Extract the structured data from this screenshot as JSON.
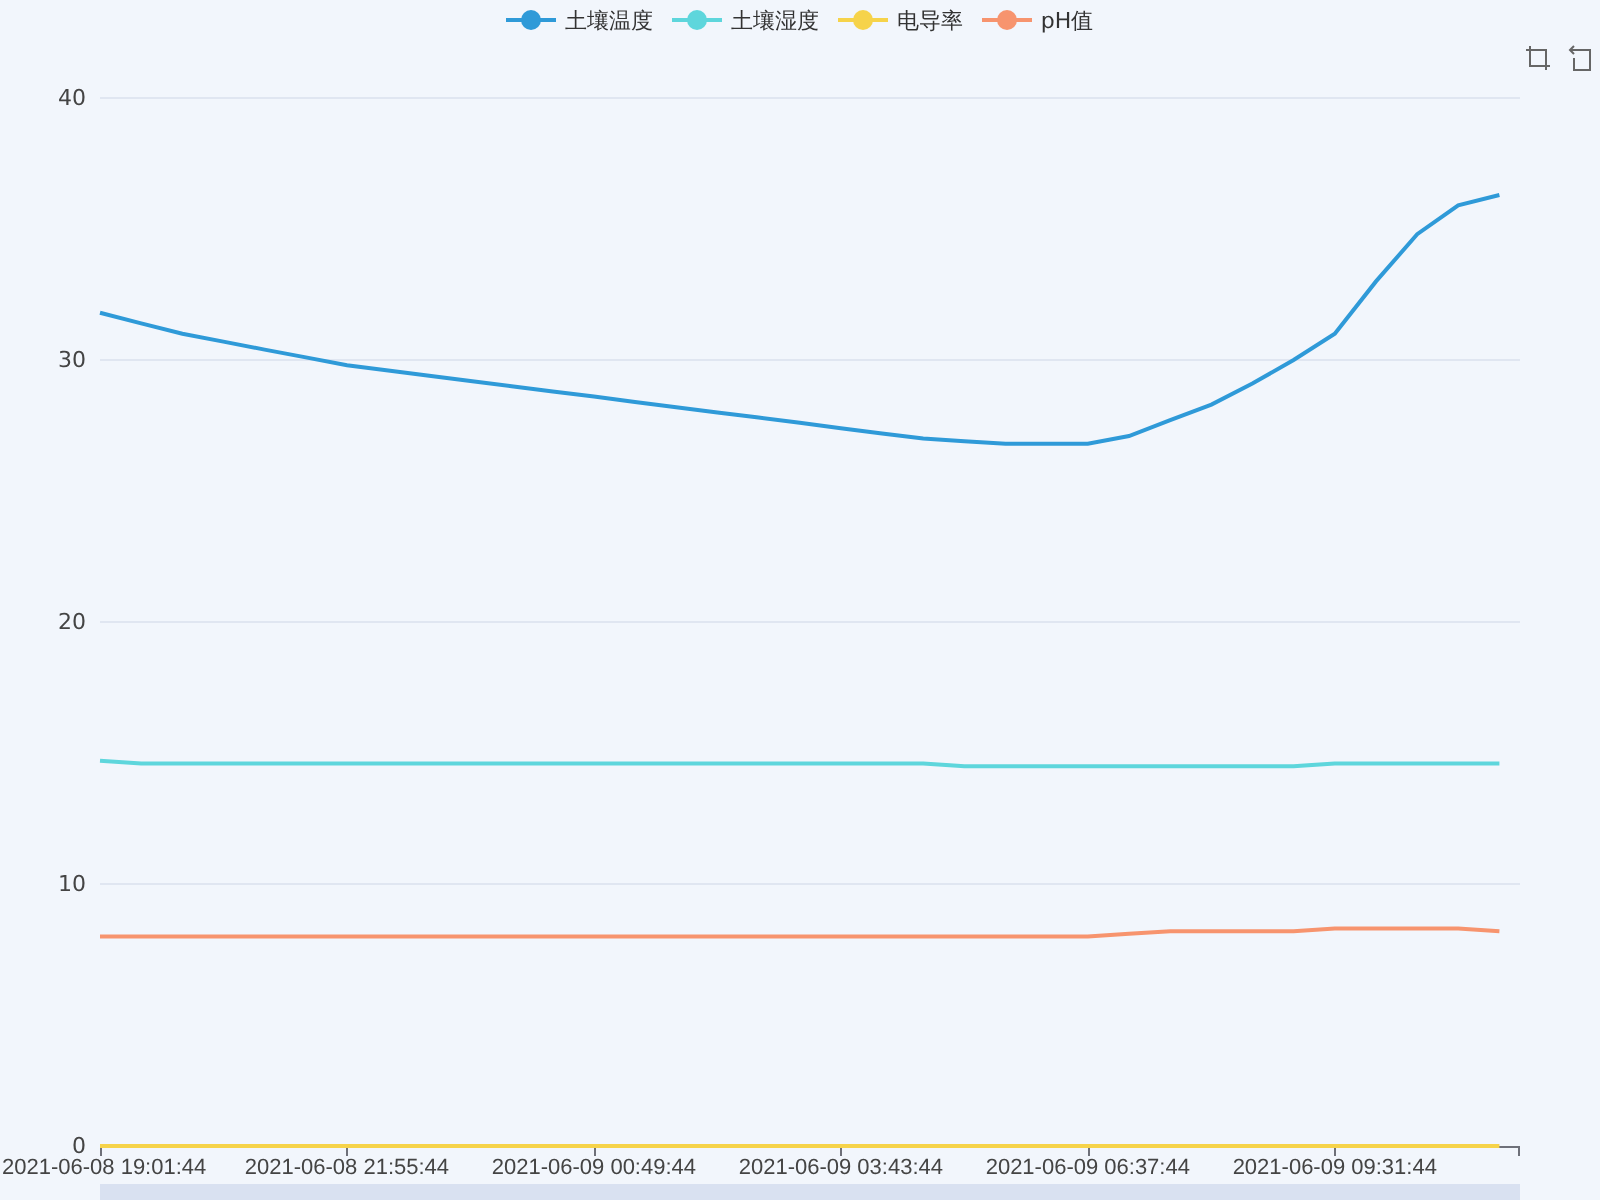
{
  "chart_data": {
    "type": "line",
    "categories": [
      "2021-06-08 19:01:44",
      null,
      null,
      null,
      null,
      null,
      "2021-06-08 21:55:44",
      null,
      null,
      null,
      null,
      null,
      "2021-06-09 00:49:44",
      null,
      null,
      null,
      null,
      null,
      "2021-06-09 03:43:44",
      null,
      null,
      null,
      null,
      null,
      "2021-06-09 06:37:44",
      null,
      null,
      null,
      null,
      null,
      "2021-06-09 09:31:44",
      null,
      null,
      null,
      null
    ],
    "ylim": [
      0,
      40
    ],
    "grid": true,
    "yticks": [
      0,
      10,
      20,
      30,
      40
    ],
    "series": [
      {
        "name": "土壤温度",
        "color": "#2f9ad8",
        "values": [
          31.8,
          31.4,
          31.0,
          30.7,
          30.4,
          30.1,
          29.8,
          29.6,
          29.4,
          29.2,
          29.0,
          28.8,
          28.6,
          28.4,
          28.2,
          28.0,
          27.8,
          27.6,
          27.4,
          27.2,
          27.0,
          26.9,
          26.8,
          26.8,
          26.8,
          27.1,
          27.7,
          28.3,
          29.1,
          30.0,
          31.0,
          33.0,
          34.8,
          35.9,
          36.3
        ]
      },
      {
        "name": "土壤湿度",
        "color": "#5ed6dc",
        "values": [
          14.7,
          14.6,
          14.6,
          14.6,
          14.6,
          14.6,
          14.6,
          14.6,
          14.6,
          14.6,
          14.6,
          14.6,
          14.6,
          14.6,
          14.6,
          14.6,
          14.6,
          14.6,
          14.6,
          14.6,
          14.6,
          14.5,
          14.5,
          14.5,
          14.5,
          14.5,
          14.5,
          14.5,
          14.5,
          14.5,
          14.6,
          14.6,
          14.6,
          14.6,
          14.6
        ]
      },
      {
        "name": "电导率",
        "color": "#f6d34a",
        "values": [
          0,
          0,
          0,
          0,
          0,
          0,
          0,
          0,
          0,
          0,
          0,
          0,
          0,
          0,
          0,
          0,
          0,
          0,
          0,
          0,
          0,
          0,
          0,
          0,
          0,
          0,
          0,
          0,
          0,
          0,
          0,
          0,
          0,
          0,
          0
        ]
      },
      {
        "name": "pH值",
        "color": "#f7946e",
        "values": [
          8.0,
          8.0,
          8.0,
          8.0,
          8.0,
          8.0,
          8.0,
          8.0,
          8.0,
          8.0,
          8.0,
          8.0,
          8.0,
          8.0,
          8.0,
          8.0,
          8.0,
          8.0,
          8.0,
          8.0,
          8.0,
          8.0,
          8.0,
          8.0,
          8.0,
          8.1,
          8.2,
          8.2,
          8.2,
          8.2,
          8.3,
          8.3,
          8.3,
          8.3,
          8.2
        ]
      }
    ]
  }
}
